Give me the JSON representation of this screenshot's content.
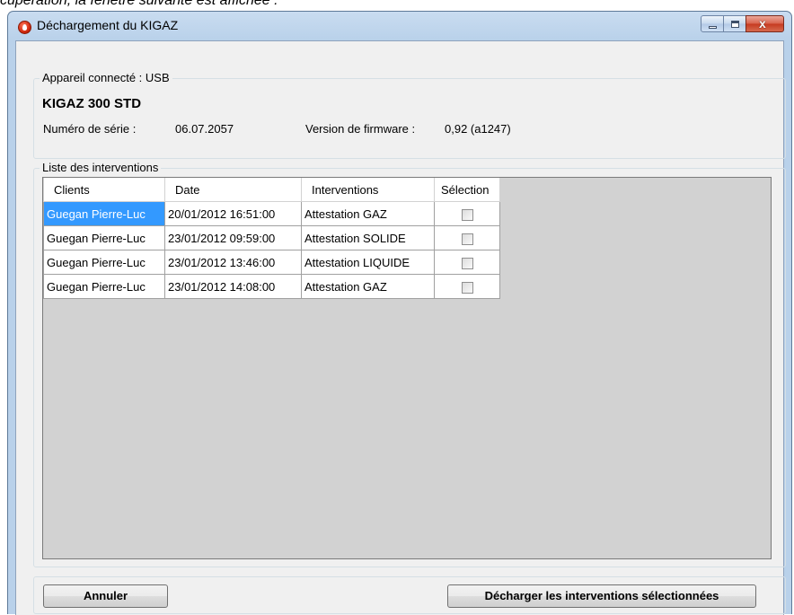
{
  "document": {
    "caption": "cupération, la fenêtre suivante est affichée :"
  },
  "window": {
    "title": "Déchargement du KIGAZ",
    "icon": "gas-flame-icon",
    "close_glyph": "x"
  },
  "device": {
    "legend": "Appareil connecté : USB",
    "name": "KIGAZ 300 STD",
    "serial_label": "Numéro de série :",
    "serial_value": "06.07.2057",
    "firmware_label": "Version de firmware :",
    "firmware_value": "0,92 (a1247)"
  },
  "interventions": {
    "legend": "Liste des interventions",
    "columns": [
      "Clients",
      "Date",
      "Interventions",
      "Sélection"
    ],
    "rows": [
      {
        "client": "Guegan Pierre-Luc",
        "date": "20/01/2012 16:51:00",
        "type": "Attestation GAZ",
        "selected": false
      },
      {
        "client": "Guegan Pierre-Luc",
        "date": "23/01/2012 09:59:00",
        "type": "Attestation SOLIDE",
        "selected": false
      },
      {
        "client": "Guegan Pierre-Luc",
        "date": "23/01/2012 13:46:00",
        "type": "Attestation LIQUIDE",
        "selected": false
      },
      {
        "client": "Guegan Pierre-Luc",
        "date": "23/01/2012 14:08:00",
        "type": "Attestation GAZ",
        "selected": false
      }
    ]
  },
  "buttons": {
    "cancel": "Annuler",
    "download": "Décharger les interventions sélectionnées"
  },
  "colors": {
    "title_bar": "#b9d1ea",
    "selection": "#3399ff",
    "grid_background": "#d2d2d2"
  }
}
